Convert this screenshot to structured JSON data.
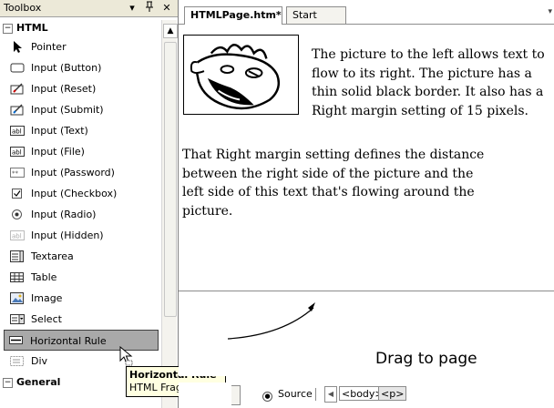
{
  "toolbox": {
    "title": "Toolbox",
    "title_controls": {
      "dropdown": "▾",
      "pin": "⎕",
      "close": "✕"
    },
    "categories": [
      {
        "name": "HTML",
        "items": [
          {
            "label": "Pointer",
            "icon": "pointer-icon"
          },
          {
            "label": "Input (Button)",
            "icon": "button-icon"
          },
          {
            "label": "Input (Reset)",
            "icon": "reset-icon"
          },
          {
            "label": "Input (Submit)",
            "icon": "submit-icon"
          },
          {
            "label": "Input (Text)",
            "icon": "textbox-icon"
          },
          {
            "label": "Input (File)",
            "icon": "file-input-icon"
          },
          {
            "label": "Input (Password)",
            "icon": "password-icon"
          },
          {
            "label": "Input (Checkbox)",
            "icon": "checkbox-icon"
          },
          {
            "label": "Input (Radio)",
            "icon": "radio-icon"
          },
          {
            "label": "Input (Hidden)",
            "icon": "hidden-input-icon"
          },
          {
            "label": "Textarea",
            "icon": "textarea-icon"
          },
          {
            "label": "Table",
            "icon": "table-icon"
          },
          {
            "label": "Image",
            "icon": "image-icon"
          },
          {
            "label": "Select",
            "icon": "select-icon"
          },
          {
            "label": "Horizontal Rule",
            "icon": "horizontal-rule-icon",
            "selected": true
          },
          {
            "label": "Div",
            "icon": "div-icon"
          }
        ]
      },
      {
        "name": "General",
        "items": []
      }
    ],
    "tooltip": {
      "title": "Horizontal Rule",
      "subtitle": "HTML Fragment"
    }
  },
  "editor": {
    "tabs": [
      {
        "label": "HTMLPage.htm*",
        "active": true
      },
      {
        "label": "Start Page",
        "active": false
      }
    ],
    "document": {
      "para1": "The picture to the left allows text to flow to its right. The picture has a thin solid black border. It also has a Right margin setting of 15 pixels.",
      "para2": "That Right margin setting defines the distance\nbetween the right side of the picture and the\nleft side of this text that's flowing around the\npicture."
    },
    "callout": "Drag to page",
    "statusbar": {
      "source_label": "Source",
      "tags": [
        "<body>",
        "<p>"
      ]
    }
  },
  "colors": {
    "selection_bg": "#a9a9a9",
    "tooltip_bg": "#ffffe1",
    "titlebar_bg": "#ece9d8"
  }
}
